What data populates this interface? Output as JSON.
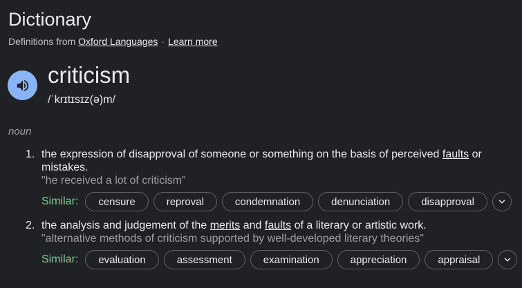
{
  "header": {
    "title": "Dictionary",
    "source_prefix": "Definitions from",
    "source_link": "Oxford Languages",
    "separator": "·",
    "learn_more": "Learn more"
  },
  "entry": {
    "word": "criticism",
    "phonetic": "/ˈkrɪtɪsɪz(ə)m/",
    "part_of_speech": "noun"
  },
  "senses": [
    {
      "number": "1.",
      "def_before": "the expression of disapproval of someone or something on the basis of perceived ",
      "def_link1": "faults",
      "def_after": " or mistakes.",
      "example": "\"he received a lot of criticism\"",
      "similar_label": "Similar:",
      "similar": [
        "censure",
        "reproval",
        "condemnation",
        "denunciation",
        "disapproval"
      ]
    },
    {
      "number": "2.",
      "def_before": "the analysis and judgement of the ",
      "def_link1": "merits",
      "def_mid": " and ",
      "def_link2": "faults",
      "def_after": " of a literary or artistic work.",
      "example": "\"alternative methods of criticism supported by well-developed literary theories\"",
      "similar_label": "Similar:",
      "similar": [
        "evaluation",
        "assessment",
        "examination",
        "appreciation",
        "appraisal"
      ]
    }
  ],
  "icons": {
    "speaker": "speaker-icon",
    "expand": "chevron-down-icon"
  },
  "colors": {
    "background": "#202124",
    "speaker_bg": "#8ab4f8",
    "similar_label": "#81c995",
    "muted": "#9aa0a6"
  }
}
